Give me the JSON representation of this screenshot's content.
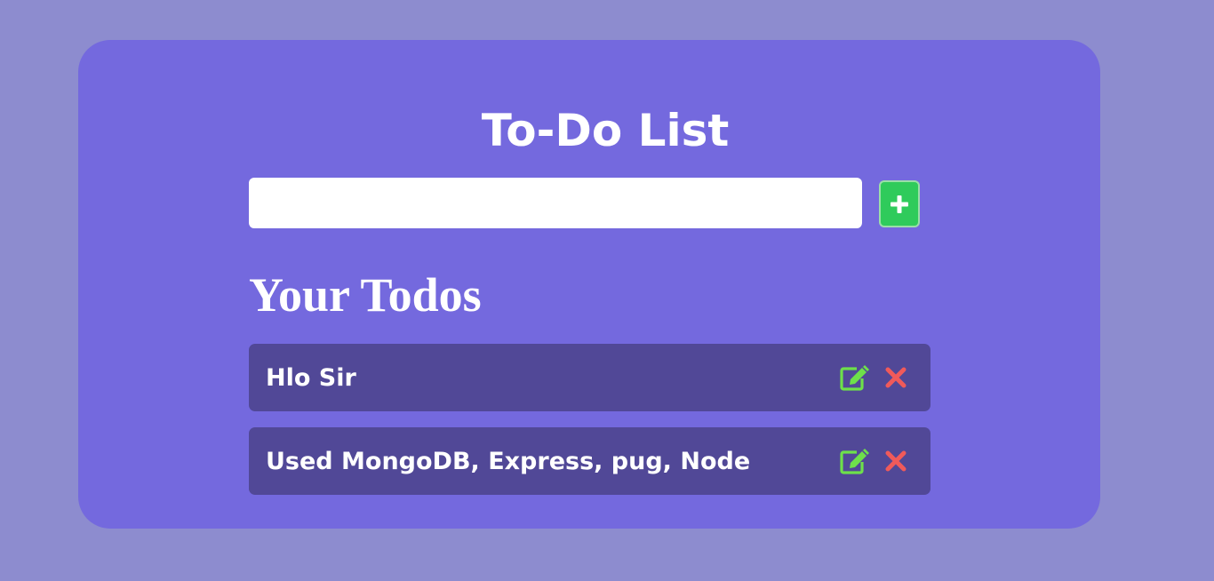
{
  "app": {
    "title": "To-Do List"
  },
  "input": {
    "value": "",
    "placeholder": ""
  },
  "add_button": {
    "icon": "plus-icon",
    "color": "#2fcb5b"
  },
  "todos_section": {
    "heading": "Your Todos"
  },
  "todos": [
    {
      "text": "Hlo Sir",
      "edit_icon": "edit-icon",
      "delete_icon": "close-icon"
    },
    {
      "text": "Used MongoDB, Express, pug, Node",
      "edit_icon": "edit-icon",
      "delete_icon": "close-icon"
    }
  ],
  "colors": {
    "page_background": "#8d8ccf",
    "card_background": "#7469de",
    "item_background": "#514897",
    "edit_icon": "#6ee04a",
    "delete_icon": "#f05a5a",
    "text": "#ffffff"
  }
}
